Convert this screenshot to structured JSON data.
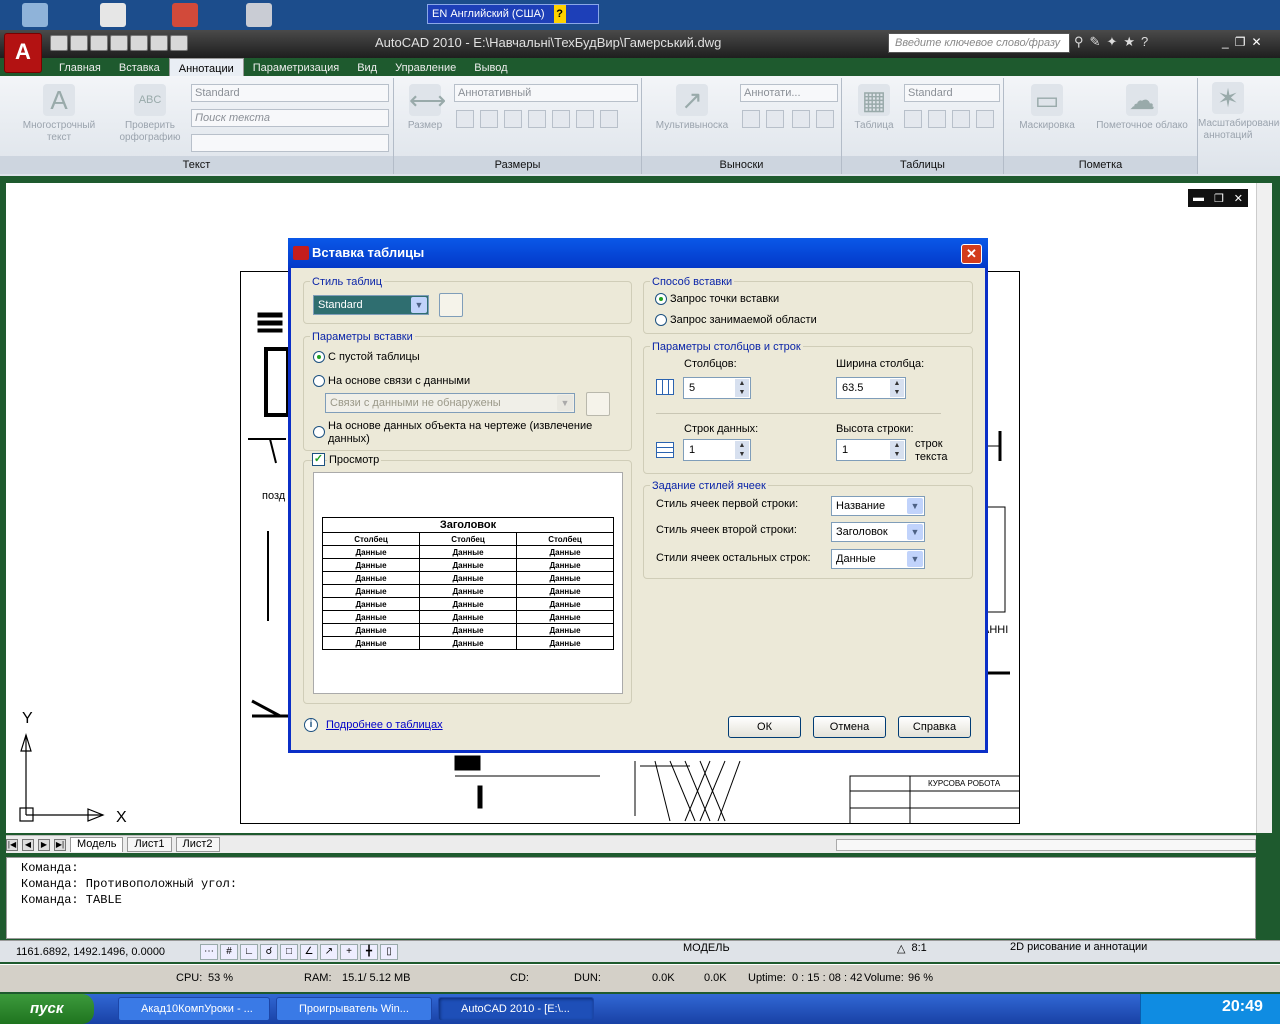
{
  "taskbar_lang": {
    "code": "EN",
    "label": "Английский (США)",
    "help": "?"
  },
  "title": {
    "app": "AutoCAD 2010 - E:\\Навчальні\\ТехБудВир\\Гамерський.dwg",
    "search_placeholder": "Введите ключевое слово/фразу"
  },
  "ribbon": {
    "tabs": [
      "Главная",
      "Вставка",
      "Аннотации",
      "Параметризация",
      "Вид",
      "Управление",
      "Вывод"
    ],
    "active_tab": "Аннотации",
    "panels": {
      "text": {
        "title": "Текст",
        "btn_mtext": "Многострочный текст",
        "btn_spell": "Проверить орфографию",
        "style_value": "Standard",
        "find_placeholder": "Поиск текста"
      },
      "dims": {
        "title": "Размеры",
        "btn_dim": "Размер",
        "style_value": "Аннотативный"
      },
      "leaders": {
        "title": "Выноски",
        "btn_mleader": "Мультивыноска",
        "style_value": "Аннотати..."
      },
      "tables": {
        "title": "Таблицы",
        "btn_table": "Таблица",
        "style_value": "Standard"
      },
      "markup": {
        "title": "Пометка",
        "btn_mask": "Маскировка",
        "btn_cloud": "Пометочное облако"
      },
      "scale": {
        "btn_scale": "Масштабирование аннотаций"
      }
    }
  },
  "drawing_tabs": {
    "model": "Модель",
    "sheet1": "Лист1",
    "sheet2": "Лист2"
  },
  "drawing_texts": {
    "ucs_y": "Y",
    "ucs_x": "X",
    "pozd": "позд",
    "anni": "АННІ",
    "title_block_1": "КУРСОВА РОБОТА"
  },
  "command_line": [
    "Команда:",
    "Команда: Противоположный угол:",
    "Команда: TABLE"
  ],
  "status": {
    "coords": "1161.6892, 1492.1496, 0.0000",
    "model": "МОДЕЛЬ",
    "anno_scale": "8:1",
    "workspace": "2D рисование и аннотации"
  },
  "monitor": {
    "cpu_label": "CPU:",
    "cpu_value": "53 %",
    "ram_label": "RAM:",
    "ram_value": "15.1/ 5.12 MB",
    "cd_label": "CD:",
    "dun_label": "DUN:",
    "rx": "0.0K",
    "tx": "0.0K",
    "uptime_label": "Uptime:",
    "uptime_value": "0 : 15 : 08 : 42",
    "volume_label": "Volume:",
    "volume_value": "96 %"
  },
  "taskbar": {
    "start": "пуск",
    "tasks": [
      "Акад10КомпУроки - ...",
      "Проигрыватель Win...",
      "AutoCAD 2010 - [E:\\..."
    ],
    "clock": "20:49"
  },
  "dialog": {
    "title": "Вставка таблицы",
    "table_style": {
      "group": "Стиль таблиц",
      "value": "Standard"
    },
    "insert_params": {
      "group": "Параметры вставки",
      "opt_empty": "С пустой таблицы",
      "opt_link": "На основе связи с данными",
      "link_value": "Связи с данными не обнаружены",
      "opt_extract": "На основе данных объекта на чертеже (извлечение данных)",
      "selected": "opt_empty"
    },
    "preview": {
      "label": "Просмотр",
      "checked": true,
      "table_title": "Заголовок",
      "col_header": "Столбец",
      "cell": "Данные",
      "columns": 3,
      "data_rows": 8
    },
    "insert_method": {
      "group": "Способ вставки",
      "opt_point": "Запрос точки вставки",
      "opt_window": "Запрос занимаемой области",
      "selected": "opt_point"
    },
    "cols_rows": {
      "group": "Параметры столбцов и строк",
      "columns_label": "Столбцов:",
      "columns_value": "5",
      "col_width_label": "Ширина столбца:",
      "col_width_value": "63.5",
      "rows_label": "Строк данных:",
      "rows_value": "1",
      "row_height_label": "Высота строки:",
      "row_height_value": "1",
      "row_height_unit": "строк текста"
    },
    "cell_styles": {
      "group": "Задание стилей ячеек",
      "first_row_label": "Стиль ячеек первой строки:",
      "first_row_value": "Название",
      "second_row_label": "Стиль ячеек второй строки:",
      "second_row_value": "Заголовок",
      "other_rows_label": "Стили ячеек остальных строк:",
      "other_rows_value": "Данные"
    },
    "more_link": "Подробнее о таблицах",
    "ok": "ОК",
    "cancel": "Отмена",
    "help": "Справка"
  }
}
